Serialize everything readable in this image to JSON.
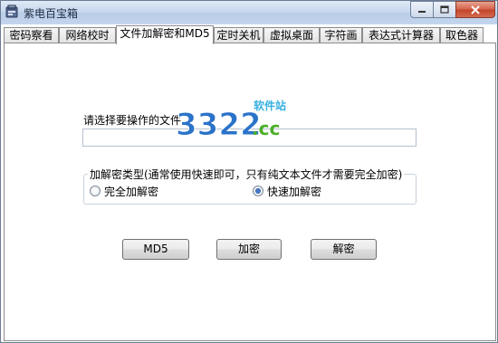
{
  "window": {
    "title": "紫电百宝箱",
    "controls": {
      "minimize": "minimize-icon",
      "maximize": "maximize-icon",
      "close": "close-icon"
    }
  },
  "tabs": [
    {
      "label": "密码察看",
      "active": false
    },
    {
      "label": "网络校时",
      "active": false
    },
    {
      "label": "文件加解密和MD5",
      "active": true
    },
    {
      "label": "定时关机",
      "active": false
    },
    {
      "label": "虚拟桌面",
      "active": false
    },
    {
      "label": "字符画",
      "active": false
    },
    {
      "label": "表达式计算器",
      "active": false
    },
    {
      "label": "取色器",
      "active": false
    }
  ],
  "file_section": {
    "label": "请选择要操作的文件",
    "value": ""
  },
  "mode_group": {
    "title": "加解密类型(通常使用快速即可，只有纯文本文件才需要完全加密)",
    "options": [
      {
        "label": "完全加解密",
        "checked": false
      },
      {
        "label": "快速加解密",
        "checked": true
      }
    ]
  },
  "buttons": {
    "md5": "MD5",
    "encrypt": "加密",
    "decrypt": "解密"
  },
  "watermark": {
    "number": "3322",
    "suffix": ".cc",
    "caption": "软件站"
  },
  "colors": {
    "accent_blue": "#2a73c9",
    "watermark_green": "#4caf2a",
    "watermark_cyan": "#35b0e0"
  }
}
